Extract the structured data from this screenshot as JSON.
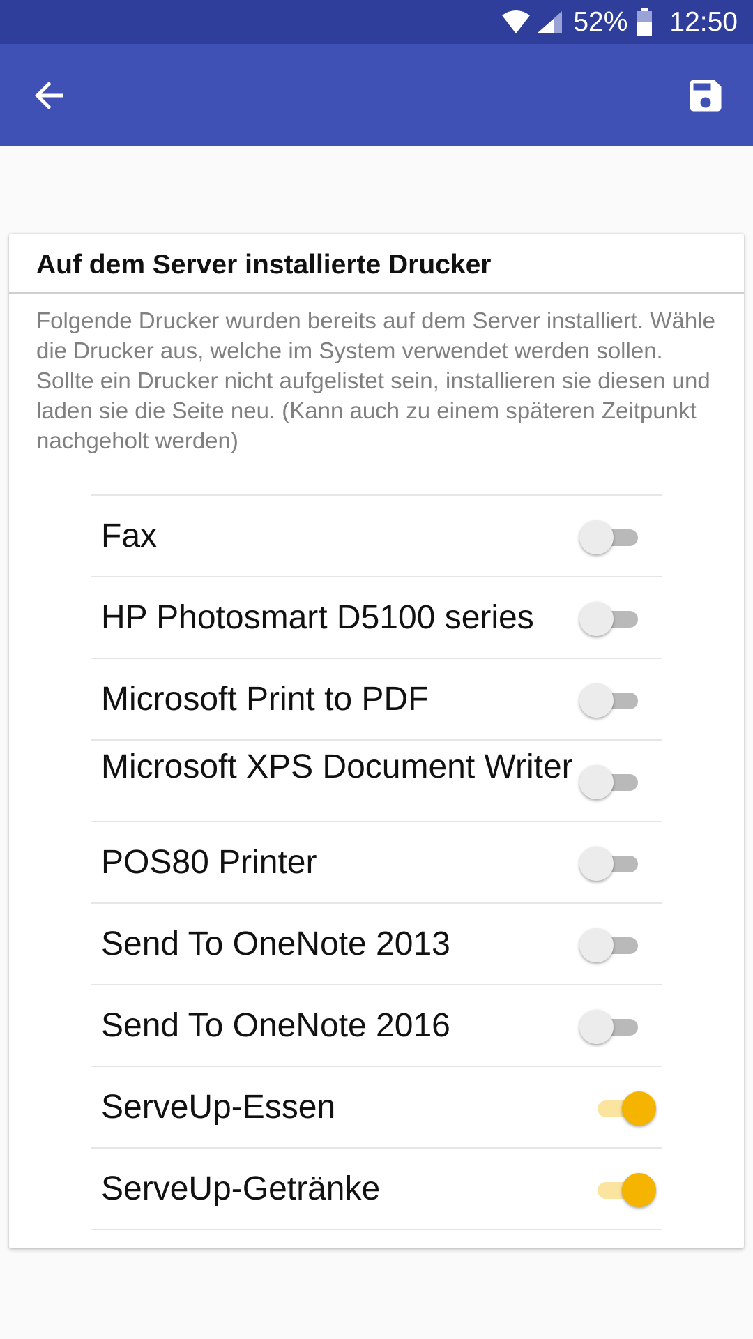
{
  "status_bar": {
    "battery_percent": "52%",
    "time": "12:50",
    "icons": [
      "wifi-icon",
      "signal-icon",
      "battery-icon"
    ]
  },
  "app_bar": {
    "back_icon": "arrow-back-icon",
    "save_icon": "save-icon",
    "colors": {
      "status_bar": "#2f3d9b",
      "app_bar": "#3f51b5"
    }
  },
  "card": {
    "title": "Auf dem Server installierte Drucker",
    "description": "Folgende Drucker wurden bereits auf dem Server installiert. Wähle die Drucker aus, welche im System verwendet werden sollen. Sollte ein Drucker nicht aufgelistet sein, installieren sie diesen und laden sie die Seite neu. (Kann auch zu einem späteren Zeitpunkt nachgeholt werden)"
  },
  "printers": [
    {
      "name": "Fax",
      "enabled": false
    },
    {
      "name": "HP Photosmart D5100 series",
      "enabled": false
    },
    {
      "name": "Microsoft Print to PDF",
      "enabled": false
    },
    {
      "name": "Microsoft XPS Document Writer",
      "enabled": false
    },
    {
      "name": "POS80 Printer",
      "enabled": false
    },
    {
      "name": "Send To OneNote 2013",
      "enabled": false
    },
    {
      "name": "Send To OneNote 2016",
      "enabled": false
    },
    {
      "name": "ServeUp-Essen",
      "enabled": true
    },
    {
      "name": "ServeUp-Getränke",
      "enabled": true
    }
  ],
  "accent_color": "#f4b400"
}
